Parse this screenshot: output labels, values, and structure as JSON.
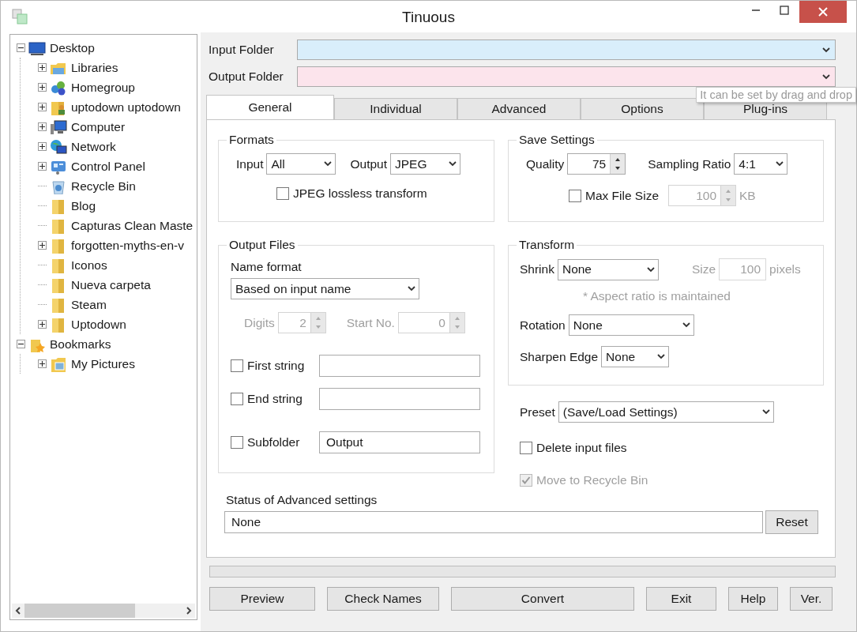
{
  "window": {
    "title": "Tinuous"
  },
  "tree": [
    {
      "label": "Desktop",
      "kind": "desktop",
      "expanded": true,
      "children": [
        {
          "label": "Libraries",
          "kind": "library",
          "expanded": false
        },
        {
          "label": "Homegroup",
          "kind": "homegroup",
          "expanded": false
        },
        {
          "label": "uptodown uptodown",
          "kind": "user",
          "expanded": false
        },
        {
          "label": "Computer",
          "kind": "computer",
          "expanded": false
        },
        {
          "label": "Network",
          "kind": "network",
          "expanded": false
        },
        {
          "label": "Control Panel",
          "kind": "control-panel",
          "expanded": false
        },
        {
          "label": "Recycle Bin",
          "kind": "recycle-bin"
        },
        {
          "label": "Blog",
          "kind": "folder"
        },
        {
          "label": "Capturas Clean Maste",
          "kind": "folder"
        },
        {
          "label": "forgotten-myths-en-v",
          "kind": "folder",
          "expanded": false
        },
        {
          "label": "Iconos",
          "kind": "folder"
        },
        {
          "label": "Nueva carpeta",
          "kind": "folder"
        },
        {
          "label": "Steam",
          "kind": "folder"
        },
        {
          "label": "Uptodown",
          "kind": "folder",
          "expanded": false
        }
      ]
    },
    {
      "label": "Bookmarks",
      "kind": "bookmarks",
      "expanded": true,
      "children": [
        {
          "label": "My Pictures",
          "kind": "pictures",
          "expanded": false
        }
      ]
    }
  ],
  "folders": [
    {
      "label": "Input Folder",
      "color": "#d9eefb"
    },
    {
      "label": "Output Folder",
      "color": "#fce4ec"
    }
  ],
  "tooltip": "It can be set by drag and drop",
  "tabs": [
    {
      "label": "General",
      "selected": true
    },
    {
      "label": "Individual",
      "selected": false
    },
    {
      "label": "Advanced",
      "selected": false
    },
    {
      "label": "Options",
      "selected": false
    },
    {
      "label": "Plug-ins",
      "selected": false
    }
  ],
  "formats": {
    "title": "Formats",
    "input_label": "Input",
    "input_value": "All",
    "output_label": "Output",
    "output_value": "JPEG",
    "lossless": {
      "label": "JPEG lossless transform",
      "checked": false
    }
  },
  "save_settings": {
    "title": "Save Settings",
    "quality_label": "Quality",
    "quality": "75",
    "sampling_label": "Sampling Ratio",
    "sampling": "4:1",
    "max_size": {
      "label": "Max File Size",
      "checked": false
    },
    "max_size_value": "100",
    "max_size_disabled": true,
    "unit": "KB"
  },
  "output_files": {
    "title": "Output Files",
    "name_format_label": "Name format",
    "name_format": "Based on input name",
    "digits_label": "Digits",
    "digits": "2",
    "start_label": "Start No.",
    "start": "0",
    "numbering_disabled": true,
    "strings": [
      {
        "label": "First string",
        "checked": false
      },
      {
        "label": "End string",
        "checked": false
      },
      {
        "label": "Subfolder",
        "checked": false,
        "value": "Output"
      }
    ]
  },
  "transform": {
    "title": "Transform",
    "shrink_label": "Shrink",
    "shrink": "None",
    "size_label": "Size",
    "size": "100",
    "size_unit": "pixels",
    "size_disabled": true,
    "note": "* Aspect ratio is maintained",
    "rotation_label": "Rotation",
    "rotation": "None",
    "sharpen_label": "Sharpen Edge",
    "sharpen": "None"
  },
  "preset": {
    "label": "Preset",
    "value": "(Save/Load Settings)"
  },
  "delete_input": {
    "label": "Delete input files",
    "checked": false
  },
  "recycle": {
    "label": "Move to Recycle Bin",
    "checked": true,
    "disabled": true
  },
  "status": {
    "label": "Status of Advanced settings",
    "value": "None",
    "reset": "Reset"
  },
  "progress": {
    "level": 0
  },
  "buttons": [
    "Preview",
    "Check Names",
    "Convert",
    "Exit",
    "Help",
    "Ver."
  ]
}
